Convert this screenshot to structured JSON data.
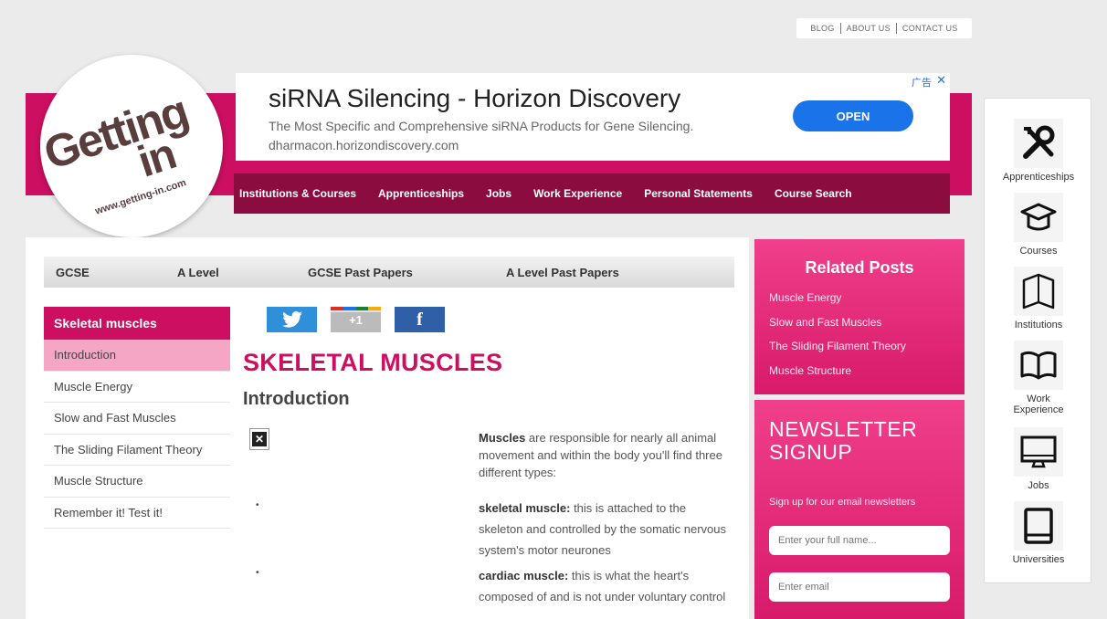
{
  "toplinks": {
    "blog": "BLOG",
    "about": "ABOUT US",
    "contact": "CONTACT US"
  },
  "logo": {
    "line1": "Getting",
    "line2": "in",
    "url": "www.getting-in.com"
  },
  "ad": {
    "title": "siRNA Silencing - Horizon Discovery",
    "description": "The Most Specific and Comprehensive siRNA Products for Gene Silencing.",
    "url": "dharmacon.horizondiscovery.com",
    "open_label": "OPEN",
    "badge": "广告",
    "close": "✕"
  },
  "mainnav": [
    "Institutions & Courses",
    "Apprenticeships",
    "Jobs",
    "Work Experience",
    "Personal Statements",
    "Course Search"
  ],
  "subnav": [
    "GCSE",
    "A Level",
    "GCSE Past Papers",
    "A Level Past Papers"
  ],
  "sidemenu": {
    "title": "Skeletal muscles",
    "items": [
      "Introduction",
      "Muscle Energy",
      "Slow and Fast Muscles",
      "The Sliding Filament Theory",
      "Muscle Structure",
      "Remember it! Test it!"
    ]
  },
  "social": {
    "twitter": "t",
    "gplus": "+1",
    "facebook": "f"
  },
  "article": {
    "title": "SKELETAL MUSCLES",
    "subtitle": "Introduction",
    "p1_bold": "Muscles",
    "p1_rest": " are responsible for nearly all animal movement and within the body you'll find three different types:",
    "b1_bold": "skeletal muscle:",
    "b1_rest": " this is attached to the skeleton and controlled by the somatic nervous system's motor neurones",
    "b2_bold": "cardiac muscle:",
    "b2_rest": " this is what the heart's composed of and is not under voluntary control",
    "bullet": "•"
  },
  "related": {
    "title": "Related Posts",
    "links": [
      "Muscle Energy",
      "Slow and Fast Muscles",
      "The Sliding Filament Theory",
      "Muscle Structure"
    ]
  },
  "newsletter": {
    "title_line1": "NEWSLETTER",
    "title_line2": "SIGNUP",
    "subtitle": "Sign up for our email newsletters",
    "name_placeholder": "Enter your full name...",
    "email_placeholder": "Enter email"
  },
  "iconbar": {
    "apprenticeships": "Apprenticeships",
    "courses": "Courses",
    "institutions": "Institutions",
    "work_line1": "Work",
    "work_line2": "Experience",
    "jobs": "Jobs",
    "universities": "Universities"
  },
  "colors": {
    "brand": "#cc0f60",
    "nav": "#8b0d3f",
    "ad_button": "#1a73e8"
  }
}
